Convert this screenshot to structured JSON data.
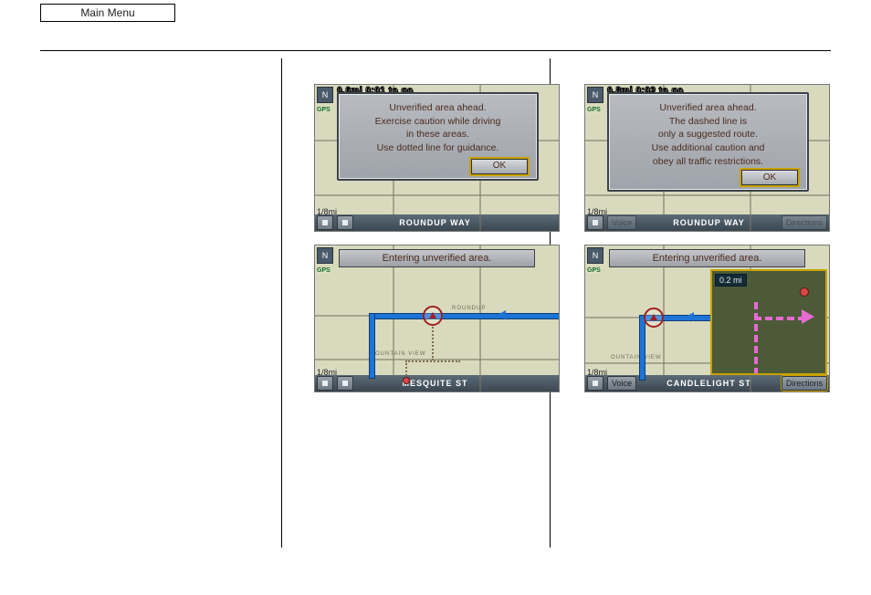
{
  "menu": {
    "label": "Main Menu"
  },
  "common": {
    "compass": "N",
    "gps": "GPS",
    "scale": "1/8mi",
    "ok": "OK",
    "icon_button_name": "icon"
  },
  "shot1": {
    "status": "0.6mi 0:01 to go",
    "modal": {
      "l1": "Unverified area ahead.",
      "l2": "Exercise caution while driving",
      "l3": "in these areas.",
      "l4": "Use dotted line for guidance."
    },
    "street": "ROUNDUP WAY"
  },
  "shot2": {
    "status": "0.8mi 0:02 to go",
    "modal": {
      "l1": "Unverified area ahead.",
      "l2": "The dashed line is",
      "l3": "only a suggested route.",
      "l4": "Use additional caution and",
      "l5": "obey all traffic restrictions."
    },
    "street": "ROUNDUP WAY",
    "voice": "Voice",
    "directions": "Directions"
  },
  "shot3": {
    "banner": "Entering unverified area.",
    "street": "MESQUITE ST",
    "label_roundup": "ROUNDUP",
    "label_mtnview": "MOUNTAIN VIEW"
  },
  "shot4": {
    "banner": "Entering unverified area.",
    "street": "CANDLELIGHT ST",
    "voice": "Voice",
    "directions": "Directions",
    "label_mtnview": "OUNTAIN VIEW",
    "pip_distance": "0.2 mi"
  }
}
